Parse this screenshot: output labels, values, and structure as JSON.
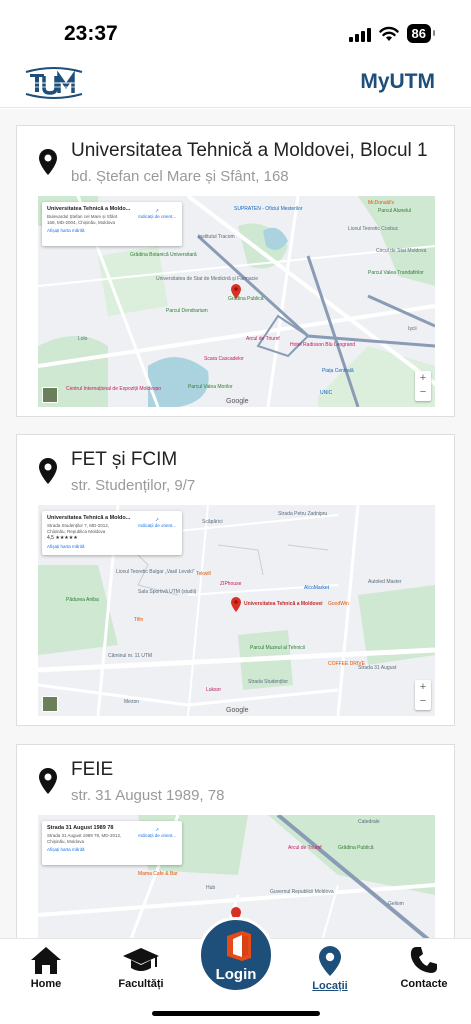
{
  "status_bar": {
    "time": "23:37",
    "battery": "86"
  },
  "header": {
    "title": "MyUTM",
    "logo_icon": "utm-logo"
  },
  "locations": [
    {
      "title": "Universitatea Tehnică a Moldovei, Blocul 1",
      "address": "bd. Ștefan cel Mare și Sfânt, 168",
      "map": {
        "info_title": "Universitatea Tehnică a Moldo...",
        "info_address": "Bulevardul Ștefan cel Mare și Sfânt 168, MD-2004, Chișinău, Moldova",
        "info_rating": "",
        "info_directions": "Indicații de orient...",
        "info_link": "Afișați harta mărită",
        "labels": [
          "SUPRATEN - Oficiul Mesterilor",
          "McDonald's",
          "Grădina Botanică Universitară",
          "Institutul Tracom",
          "Liceul Teoretic Cosbuc",
          "Circul de Stat Moldova",
          "Universitatea de Stat de Medicină și Farmacie",
          "Parcul Dendrarium",
          "Parcul Valea Trandafirilor",
          "Arcul de Triumf",
          "Hotel Radisson Blu Leogrand",
          "Scara Cascadelor",
          "Piața Centrală",
          "Centrul Internațional de Expoziții Moldexpo",
          "Parcul Valea Morilor",
          "UNIC",
          "Parcul Alunelul",
          "Ișcii",
          "Grădina Publică",
          "Lolo"
        ]
      }
    },
    {
      "title": "FET și FCIM",
      "address": "str. Studenților, 9/7",
      "map": {
        "info_title": "Universitatea Tehnică a Moldo...",
        "info_address": "Strada Studenților 7, MD-2012, Chișinău, Republica Moldova",
        "info_rating": "4,5 ★★★★★",
        "info_directions": "Indicații de orient...",
        "info_link": "Afișați harta mărită",
        "labels": [
          "Strada Petru Zadnipru",
          "Scăpărici",
          "Tekwill",
          "Liceul Teoretic Bulgar „Vasil Levski”",
          "Sala Sportivă UTM (studii)",
          "ZIPhouse",
          "AlcoMarket",
          "Autoled Master",
          "Pădurea Aniba",
          "Universitatea Tehnică a Moldovei",
          "GoodWin",
          "Tifin",
          "Căminul nr. 11 UTM",
          "Parcul Muzeul al Tehnicii",
          "COFFEE DRIVE",
          "Strada Studenților",
          "Luksor",
          "Mezon",
          "Strada 31 August"
        ]
      }
    },
    {
      "title": "FEIE",
      "address": "str. 31 August 1989, 78",
      "map": {
        "info_title": "Strada 31 August 1989 78",
        "info_address": "Strada 31 August 1989 78, MD-2012, Chișinău, Moldova",
        "info_rating": "",
        "info_directions": "Indicații de orient...",
        "info_link": "Afișați harta mărită",
        "labels": [
          "Catedrale",
          "Arcul de Triumf",
          "Mama Cafe & Bar",
          "Guvernul Republicii Moldova",
          "Hub",
          "Grădina Publică",
          "Geliom"
        ]
      }
    }
  ],
  "zoom": {
    "plus": "+",
    "minus": "−"
  },
  "google_label": "Google",
  "bottom_nav": {
    "home": "Home",
    "faculties": "Facultăți",
    "login": "Login",
    "locations": "Locații",
    "contacts": "Contacte"
  },
  "colors": {
    "brand": "#1d4f7a",
    "pin": "#111111",
    "map_marker": "#d93025"
  }
}
